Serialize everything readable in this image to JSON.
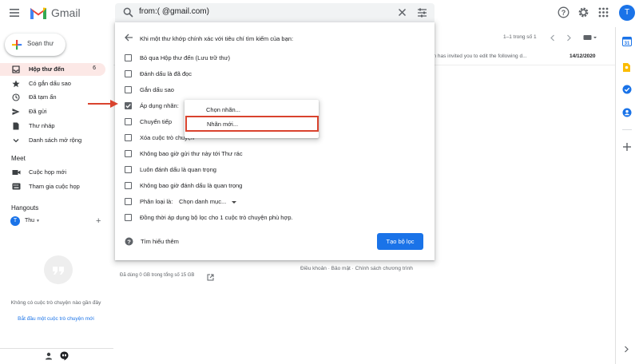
{
  "app": {
    "name": "Gmail"
  },
  "search": {
    "query": "from:(           @gmail.com)"
  },
  "compose": {
    "label": "Soạn thư"
  },
  "sidebar": {
    "items": [
      {
        "label": "Hộp thư đến",
        "count": "6"
      },
      {
        "label": "Có gắn dấu sao"
      },
      {
        "label": "Đã tạm ẩn"
      },
      {
        "label": "Đã gửi"
      },
      {
        "label": "Thư nháp"
      },
      {
        "label": "Danh sách mở rộng"
      }
    ],
    "meet": {
      "title": "Meet",
      "items": [
        {
          "label": "Cuộc họp mới"
        },
        {
          "label": "Tham gia cuộc họp"
        }
      ]
    },
    "hangouts": {
      "title": "Hangouts",
      "user_initial": "T",
      "user_name": "Thu",
      "no_chats": "Không có cuộc trò chuyện nào gần đây",
      "start_link": "Bắt đầu một cuộc trò chuyện mới"
    }
  },
  "account": {
    "initial": "T"
  },
  "list": {
    "pagination": "1–1 trong số 1",
    "email": {
      "snippet": "om has invited you to edit the following d...",
      "date": "14/12/2020"
    },
    "storage": "Đã dùng 0 GB trong tổng số 15 GB",
    "footer": "Điều khoản · Bảo mật · Chính sách chương trình"
  },
  "filter": {
    "header": "Khi một thư khớp chính xác với tiêu chí tìm kiếm của bạn:",
    "options": [
      {
        "label": "Bỏ qua Hộp thư đến (Lưu trữ thư)",
        "checked": false
      },
      {
        "label": "Đánh dấu là đã đọc",
        "checked": false
      },
      {
        "label": "Gắn dấu sao",
        "checked": false
      },
      {
        "label": "Áp dụng nhãn:",
        "checked": true
      },
      {
        "label": "Chuyển tiếp",
        "checked": false
      },
      {
        "label": "Xóa cuộc trò chuyện",
        "checked": false
      },
      {
        "label": "Không bao giờ gửi thư này tới Thư rác",
        "checked": false
      },
      {
        "label": "Luôn đánh dấu là quan trọng",
        "checked": false
      },
      {
        "label": "Không bao giờ đánh dấu là quan trọng",
        "checked": false
      },
      {
        "label": "Phân loại là:",
        "checked": false
      },
      {
        "label": "Đồng thời áp dụng bộ lọc cho 1 cuộc trò chuyện phù hợp.",
        "checked": false
      }
    ],
    "classify_value": "Chọn danh mục...",
    "learn_more": "Tìm hiểu thêm",
    "create_button": "Tạo bộ lọc"
  },
  "label_menu": {
    "choose": "Chọn nhãn...",
    "new": "Nhãn mới..."
  },
  "colors": {
    "accent": "#1a73e8",
    "highlight": "#d9432e",
    "inbox_bg": "#fce8e6"
  }
}
